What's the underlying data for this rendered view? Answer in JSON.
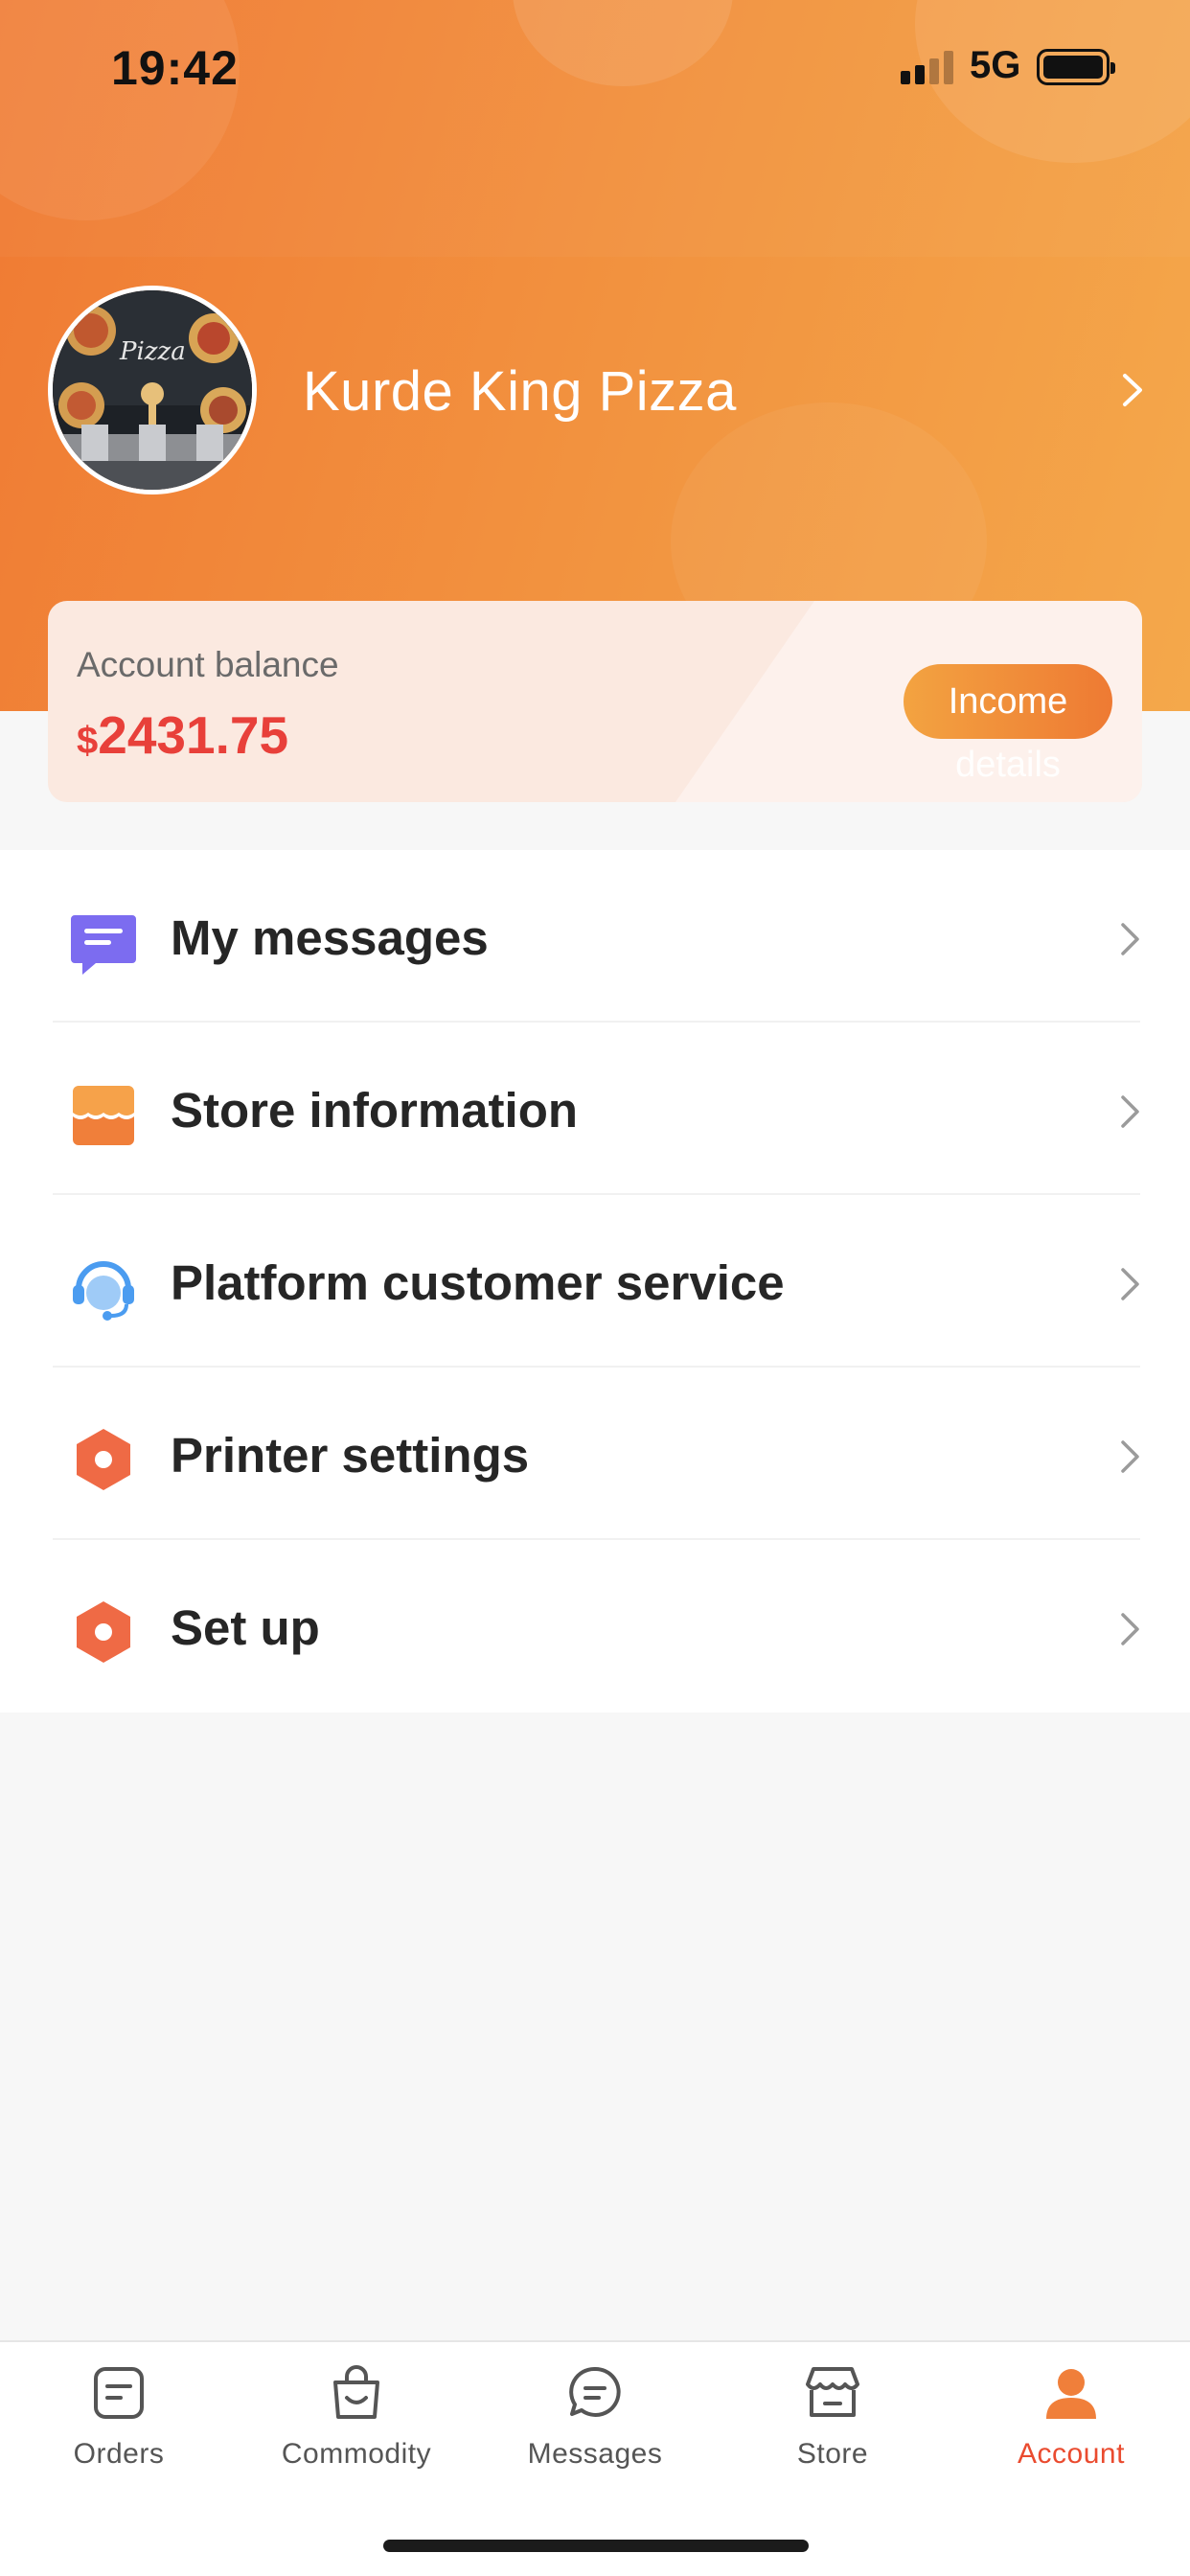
{
  "status_bar": {
    "time": "19:42",
    "network": "5G",
    "signal_bars_active": 2,
    "signal_bars_total": 4,
    "battery_level": 1.0
  },
  "profile": {
    "store_name": "Kurde King Pizza",
    "avatar_icon": "pizza-restaurant-photo"
  },
  "balance": {
    "label": "Account balance",
    "currency_symbol": "$",
    "amount": "2431.75",
    "button_line1": "Income",
    "button_line2": "details"
  },
  "menu": [
    {
      "label": "My messages",
      "icon": "message-icon",
      "color": "#7c6cf0"
    },
    {
      "label": "Store information",
      "icon": "store-icon",
      "color": "#f59440"
    },
    {
      "label": "Platform customer service",
      "icon": "headset-icon",
      "color": "#4b9cf0"
    },
    {
      "label": "Printer settings",
      "icon": "hexagon-gear-icon",
      "color": "#ef6a45"
    },
    {
      "label": "Set up",
      "icon": "hexagon-gear-icon",
      "color": "#ef6a45"
    }
  ],
  "tabbar": {
    "active": "Account",
    "active_color": "#ea4b2f",
    "tabs": [
      {
        "label": "Orders",
        "icon": "orders-icon"
      },
      {
        "label": "Commodity",
        "icon": "shopping-bag-icon"
      },
      {
        "label": "Messages",
        "icon": "chat-bubble-icon"
      },
      {
        "label": "Store",
        "icon": "store-icon"
      },
      {
        "label": "Account",
        "icon": "account-icon"
      }
    ]
  },
  "colors": {
    "header_start": "#f07a33",
    "header_end": "#f4a84b",
    "balance_amount": "#e8403a"
  }
}
